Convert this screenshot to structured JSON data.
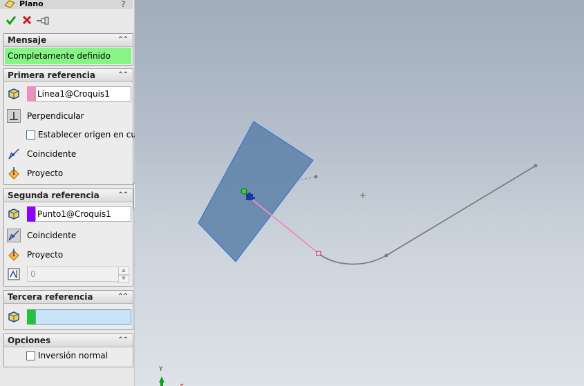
{
  "panel": {
    "title": "Plano",
    "help_label": "?",
    "actions": {
      "ok": "accept-checkmark",
      "cancel": "cancel-x",
      "pin": "pushpin"
    },
    "message": {
      "title": "Mensaje",
      "text": "Completamente definido",
      "color": "#86f586"
    },
    "first_reference": {
      "title": "Primera referencia",
      "entity": "Línea1@Croquis1",
      "swatch_color": "#f08ec0",
      "constraints": [
        "Perpendicular",
        "Coincidente",
        "Proyecto"
      ],
      "checkbox_label": "Establecer origen en curv",
      "checkbox_checked": false
    },
    "second_reference": {
      "title": "Segunda referencia",
      "entity": "Punto1@Croquis1",
      "swatch_color": "#8b00ff",
      "constraints": [
        "Coincidente",
        "Proyecto"
      ],
      "value": "0"
    },
    "third_reference": {
      "title": "Tercera referencia",
      "entity": "",
      "swatch_color": "#23c23a",
      "field_color": "#c9e3f9"
    },
    "options": {
      "title": "Opciones",
      "checkbox_label": "Inversión normal",
      "checkbox_checked": false
    }
  },
  "viewport": {
    "axis_label": "Y",
    "plane_color": "#5c80a8",
    "line_color": "#f08ec0",
    "curve_color": "#7c7c7c",
    "origin_color": "#1a3aa0"
  }
}
